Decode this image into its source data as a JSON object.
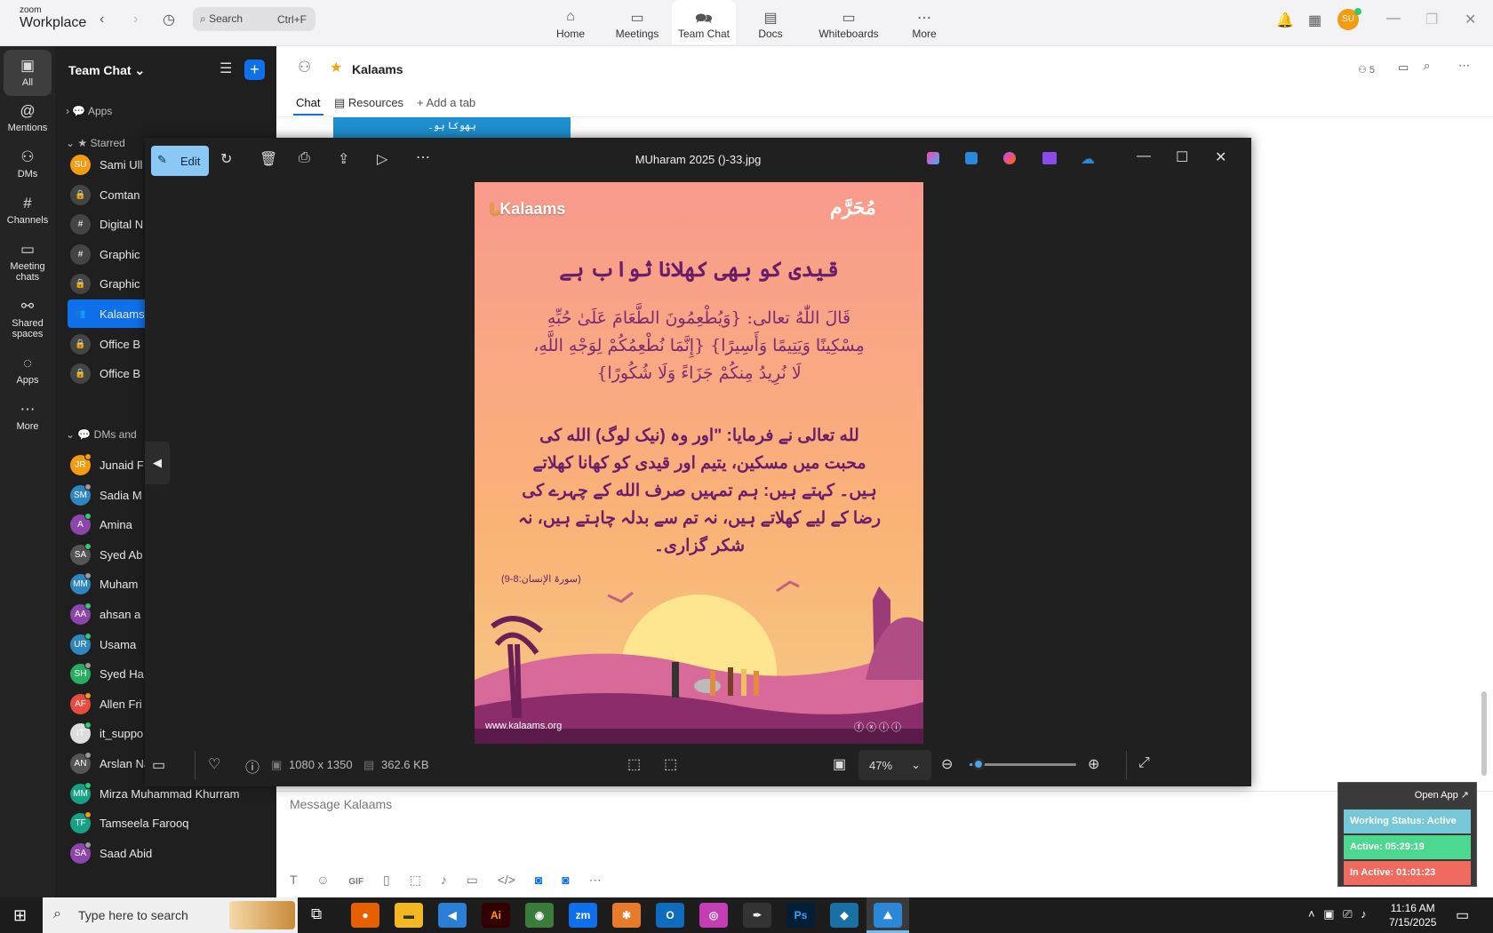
{
  "app": {
    "brand_small": "zoom",
    "brand": "Workplace"
  },
  "titlebar": {
    "search_label": "Search",
    "search_shortcut": "Ctrl+F",
    "nav": [
      {
        "label": "Home",
        "icon": "home-icon"
      },
      {
        "label": "Meetings",
        "icon": "video-icon"
      },
      {
        "label": "Team Chat",
        "icon": "chat-icon"
      },
      {
        "label": "Docs",
        "icon": "doc-icon"
      },
      {
        "label": "Whiteboards",
        "icon": "whiteboard-icon"
      },
      {
        "label": "More",
        "icon": "more-icon"
      }
    ],
    "user_initials": "SU"
  },
  "rail": [
    {
      "label": "All",
      "icon": "chat-bubble-icon"
    },
    {
      "label": "Mentions",
      "icon": "at-icon"
    },
    {
      "label": "DMs",
      "icon": "people-icon"
    },
    {
      "label": "Channels",
      "icon": "hash-icon"
    },
    {
      "label": "Meeting chats",
      "icon": "calendar-icon"
    },
    {
      "label": "Shared spaces",
      "icon": "shared-icon"
    },
    {
      "label": "Apps",
      "icon": "apps-icon"
    },
    {
      "label": "More",
      "icon": "more-icon"
    }
  ],
  "sidebar": {
    "title": "Team Chat",
    "apps_label": "Apps",
    "starred_label": "Starred",
    "starred": [
      {
        "label": "Sami Ull",
        "av": "SU",
        "color": "#f39c12"
      },
      {
        "label": "Comtan",
        "av": "🔒",
        "color": "#444"
      },
      {
        "label": "Digital N",
        "av": "#",
        "color": "#444"
      },
      {
        "label": "Graphic",
        "av": "#",
        "color": "#444"
      },
      {
        "label": "Graphic",
        "av": "🔒",
        "color": "#444"
      },
      {
        "label": "Kalaams",
        "av": "👥",
        "color": "#0e71eb"
      },
      {
        "label": "Office B",
        "av": "🔒",
        "color": "#444"
      },
      {
        "label": "Office B",
        "av": "🔒",
        "color": "#444"
      }
    ],
    "dms_label": "DMs and",
    "dms": [
      {
        "label": "Junaid F",
        "av": "JR",
        "color": "#f39c12"
      },
      {
        "label": "Sadia M",
        "av": "SM",
        "color": "#2e86c1"
      },
      {
        "label": "Amina",
        "av": "A",
        "color": "#8e44ad"
      },
      {
        "label": "Syed Ab",
        "av": "SA",
        "color": "#555"
      },
      {
        "label": "Muham",
        "av": "MM",
        "color": "#2e86c1"
      },
      {
        "label": "ahsan a",
        "av": "AA",
        "color": "#8e44ad"
      },
      {
        "label": "Usama",
        "av": "UR",
        "color": "#2e86c1"
      },
      {
        "label": "Syed Ha",
        "av": "SH",
        "color": "#27ae60"
      },
      {
        "label": "Allen Fri",
        "av": "AF",
        "color": "#e74c3c"
      },
      {
        "label": "it_suppo",
        "av": "IT",
        "color": "#ddd"
      },
      {
        "label": "Arslan Naeem",
        "av": "AN",
        "color": "#555"
      },
      {
        "label": "Mirza Muhammad Khurram",
        "av": "MM",
        "color": "#16a085"
      },
      {
        "label": "Tamseela Farooq",
        "av": "TF",
        "color": "#16a085"
      },
      {
        "label": "Saad Abid",
        "av": "SA",
        "color": "#8e44ad"
      }
    ]
  },
  "channel": {
    "name": "Kalaams",
    "members": "5",
    "tabs": {
      "chat": "Chat",
      "resources": "Resources",
      "add": "Add a tab"
    },
    "composer_placeholder": "Message Kalaams"
  },
  "viewer": {
    "edit_label": "Edit",
    "filename": "MUharam 2025 ()-33.jpg",
    "dimensions": "1080 x 1350",
    "filesize": "362.6 KB",
    "zoom": "47%",
    "zoom_level": 0.08
  },
  "poster": {
    "brand": "Kalaams",
    "corner": "مُحَرَّم",
    "heading": "قیدی کو بھی کھلانا ثواب ہے",
    "arabic_1": "قَالَ اللّٰهُ تعالی: {وَيُطْعِمُونَ الطَّعَامَ عَلَىٰ حُبِّهِ",
    "arabic_2": "مِسْكِينًا وَيَتِيمًا وَأَسِيرًا} {إِنَّمَا نُطْعِمُكُمْ لِوَجْهِ اللَّهِ،",
    "arabic_3": "لَا نُرِيدُ مِنكُمْ جَزَاءً وَلَا شُكُورًا}",
    "urdu_1": "لله تعالی نے فرمایا: \"اور وہ (نیک لوگ) الله کی",
    "urdu_2": "محبت میں مسکین، یتیم اور قیدی کو کھانا کھلاتے",
    "urdu_3": "ہیں۔ کہتے ہیں: ہم تمہیں صرف الله کے چہرے کی",
    "urdu_4": "رضا کے لیے کھلاتے ہیں، نہ تم سے بدلہ چاہتے ہیں، نہ",
    "urdu_5": "شکر گزاری۔",
    "reference": "(سورۃ الإنسان:8-9)",
    "website": "www.kalaams.org"
  },
  "partial_message": "بھوکا ہو۔",
  "status_widget": {
    "open_app": "Open App ↗",
    "working": "Working Status: Active",
    "active": "Active: 05:29:19",
    "inactive": "In Active: 01:01:23"
  },
  "taskbar": {
    "search_placeholder": "Type here to search",
    "time": "11:16 AM",
    "date": "7/15/2025"
  }
}
